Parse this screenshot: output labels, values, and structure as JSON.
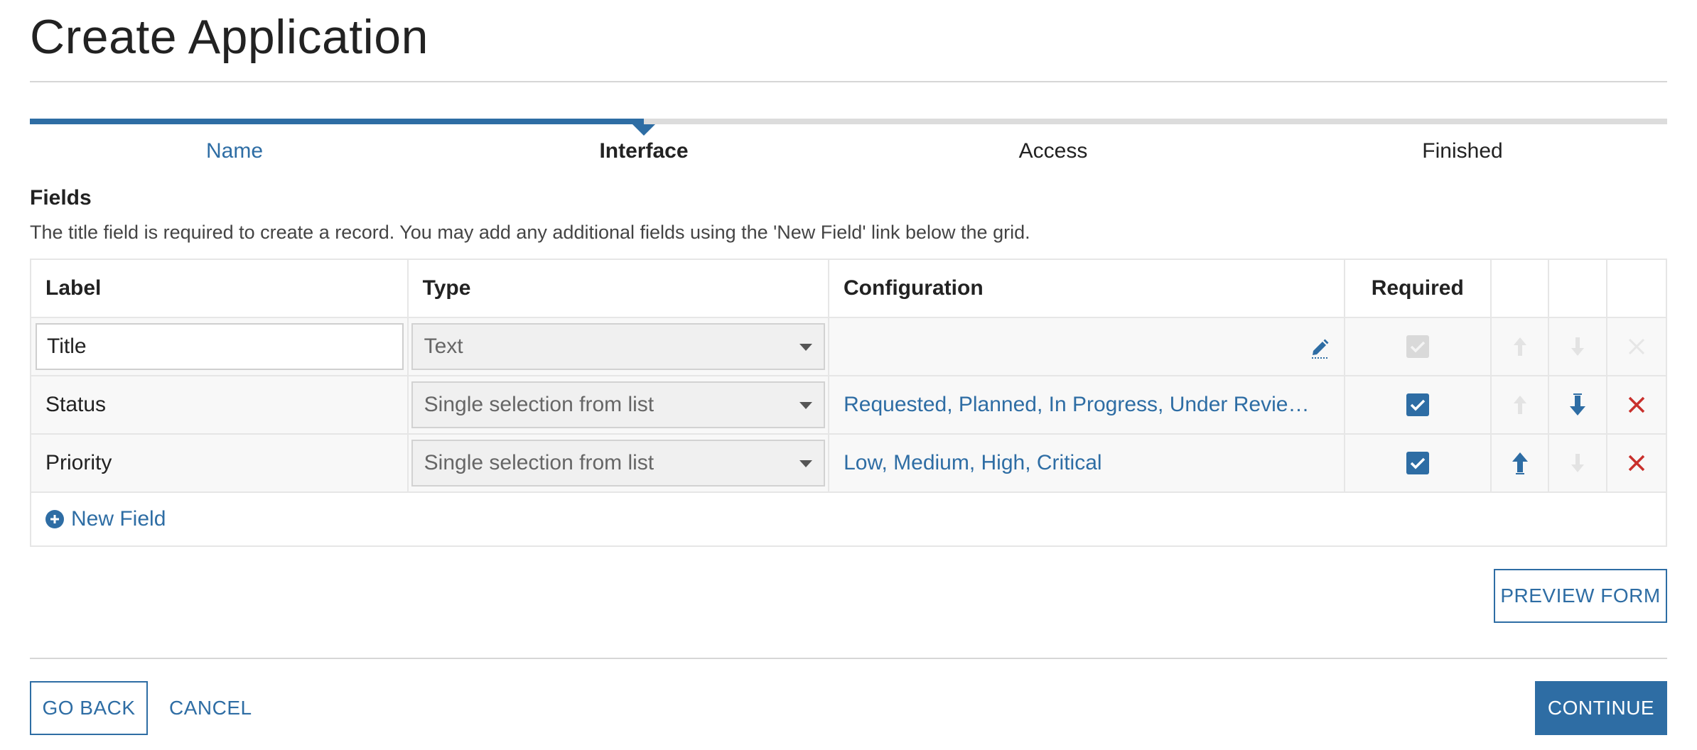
{
  "page": {
    "title": "Create Application"
  },
  "wizard": {
    "progress_percent": 37.5,
    "steps": [
      {
        "label": "Name",
        "state": "done"
      },
      {
        "label": "Interface",
        "state": "active"
      },
      {
        "label": "Access",
        "state": "upcoming"
      },
      {
        "label": "Finished",
        "state": "upcoming"
      }
    ]
  },
  "fields_section": {
    "title": "Fields",
    "description": "The title field is required to create a record. You may add any additional fields using the 'New Field' link below the grid."
  },
  "grid": {
    "columns": {
      "label": "Label",
      "type": "Type",
      "configuration": "Configuration",
      "required": "Required"
    },
    "rows": [
      {
        "label": "Title",
        "type": "Text",
        "configuration": "",
        "required": true,
        "required_editable": false,
        "can_move_up": false,
        "can_move_down": false,
        "can_delete": false
      },
      {
        "label": "Status",
        "type": "Single selection from list",
        "configuration": "Requested, Planned, In Progress, Under Review, Completed",
        "required": true,
        "required_editable": true,
        "can_move_up": false,
        "can_move_down": true,
        "can_delete": true
      },
      {
        "label": "Priority",
        "type": "Single selection from list",
        "configuration": "Low, Medium, High, Critical",
        "required": true,
        "required_editable": true,
        "can_move_up": true,
        "can_move_down": false,
        "can_delete": true
      }
    ],
    "new_field_label": "New Field"
  },
  "actions": {
    "preview_label": "PREVIEW FORM",
    "back_label": "GO BACK",
    "cancel_label": "CANCEL",
    "continue_label": "CONTINUE"
  },
  "colors": {
    "accent": "#2e6da4",
    "danger": "#c9302c",
    "disabled": "#d9d9d9"
  },
  "icons": {
    "edit": "pencil-icon",
    "move_up": "arrow-up-icon",
    "move_down": "arrow-down-icon",
    "delete": "close-icon",
    "check": "check-icon",
    "add": "plus-circle-icon"
  }
}
